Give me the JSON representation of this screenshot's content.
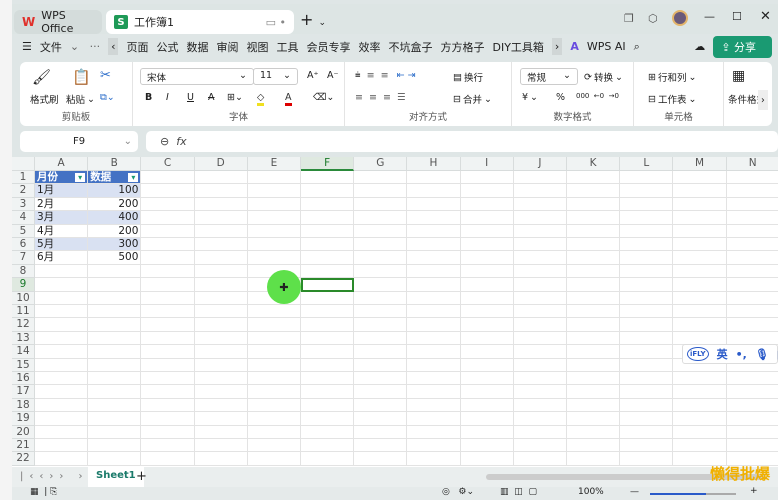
{
  "tabs": [
    {
      "label": "WPS Office",
      "icon": "wps-logo-icon"
    },
    {
      "label": "工作簿1",
      "icon": "spreadsheet-icon"
    }
  ],
  "menu": {
    "file": "文件",
    "items": [
      "页面",
      "公式",
      "数据",
      "审阅",
      "视图",
      "工具",
      "会员专享",
      "效率",
      "不坑盒子",
      "方方格子",
      "DIY工具箱"
    ],
    "ai": "WPS AI",
    "share": "分享"
  },
  "ribbon": {
    "clipboard": {
      "label": "剪贴板",
      "format_painter": "格式刷",
      "paste": "粘贴"
    },
    "font": {
      "label": "字体",
      "font_name": "宋体",
      "font_size": "11",
      "bold": "B",
      "italic": "I",
      "underline": "U",
      "strike": "A"
    },
    "align": {
      "label": "对齐方式",
      "wrap": "换行",
      "merge": "合并"
    },
    "number": {
      "label": "数字格式",
      "format": "常规",
      "convert": "转换",
      "currency": "¥",
      "percent": "%"
    },
    "cells": {
      "label": "单元格",
      "rowcol": "行和列",
      "worksheet": "工作表"
    },
    "cond": {
      "label": "条件格式"
    }
  },
  "formula_bar": {
    "name_box": "F9",
    "fx": "fx",
    "value": ""
  },
  "columns": [
    "A",
    "B",
    "C",
    "D",
    "E",
    "F",
    "G",
    "H",
    "I",
    "J",
    "K",
    "L",
    "M",
    "N"
  ],
  "rows": [
    "1",
    "2",
    "3",
    "4",
    "5",
    "6",
    "7",
    "8",
    "9",
    "10",
    "11",
    "12",
    "13",
    "14",
    "15",
    "16",
    "17",
    "18",
    "19",
    "20",
    "21",
    "22"
  ],
  "table": {
    "headers": [
      "月份",
      "数据"
    ],
    "rows": [
      [
        "1月",
        "100"
      ],
      [
        "2月",
        "200"
      ],
      [
        "3月",
        "400"
      ],
      [
        "4月",
        "200"
      ],
      [
        "5月",
        "300"
      ],
      [
        "6月",
        "500"
      ]
    ],
    "header_color": "#4472c4",
    "band_color": "#d9e1f2"
  },
  "selected_cell": "F9",
  "sheet_tabs": [
    {
      "label": "Sheet1",
      "active": true
    }
  ],
  "status": {
    "zoom": "100%"
  },
  "ime": {
    "lang": "英"
  },
  "watermark": "懒得批爆"
}
